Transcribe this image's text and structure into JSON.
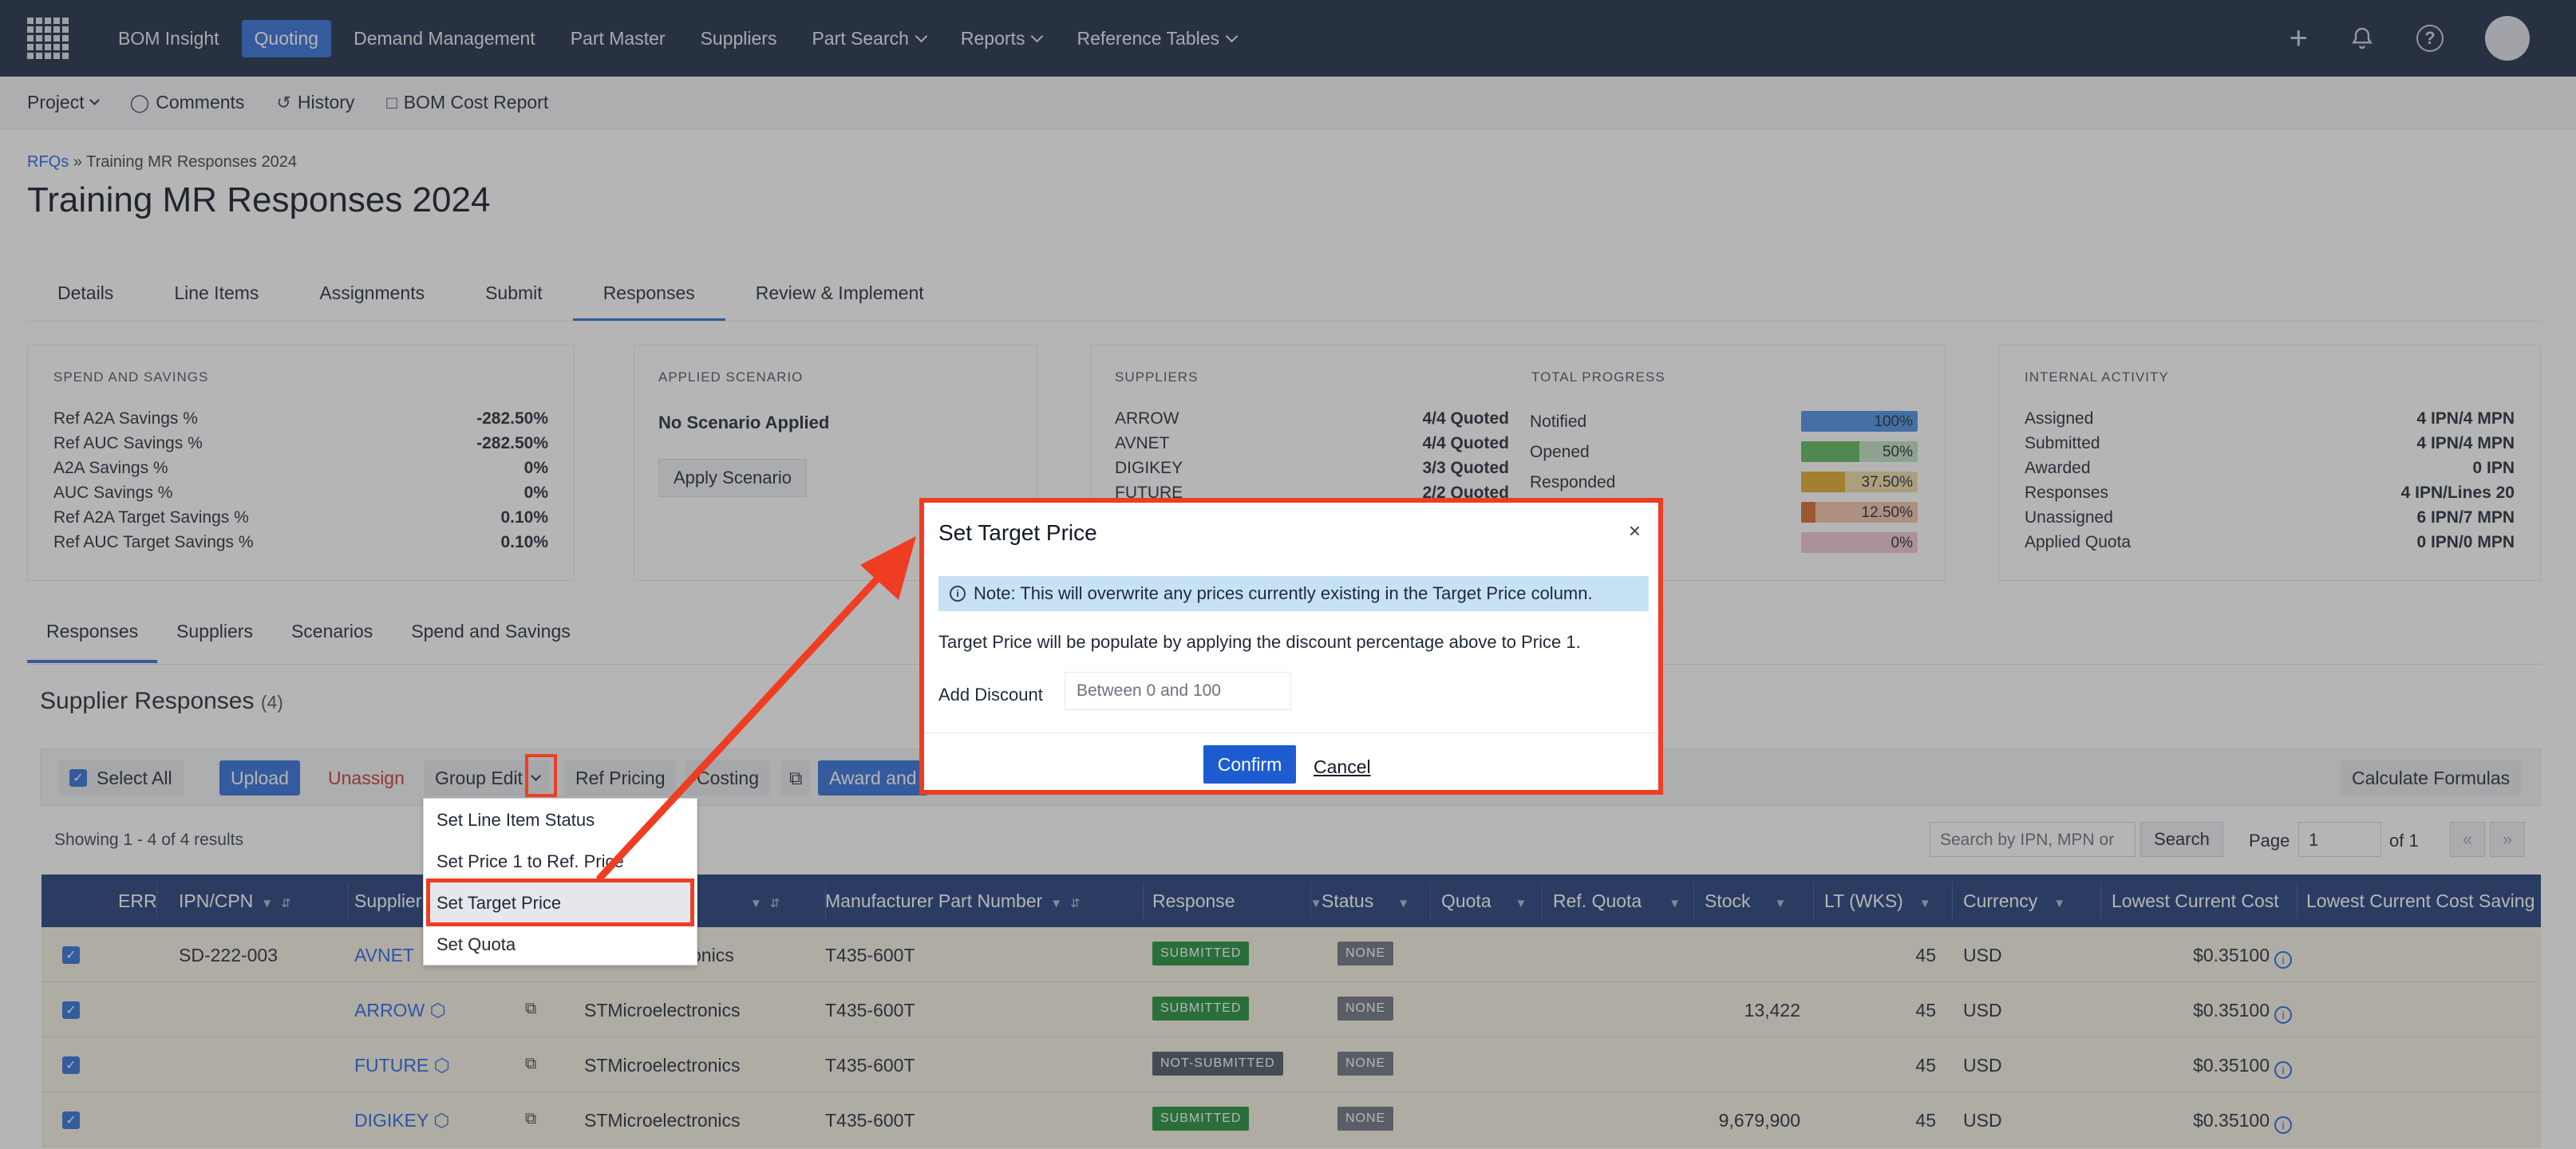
{
  "nav": {
    "items": [
      {
        "label": "BOM Insight"
      },
      {
        "label": "Quoting"
      },
      {
        "label": "Demand Management"
      },
      {
        "label": "Part Master"
      },
      {
        "label": "Suppliers"
      },
      {
        "label": "Part Search"
      },
      {
        "label": "Reports"
      },
      {
        "label": "Reference Tables"
      }
    ],
    "plus": "+",
    "help": "?"
  },
  "subbar": {
    "project": "Project",
    "comments": "Comments",
    "history": "History",
    "bom_cost_report": "BOM Cost Report"
  },
  "breadcrumb": {
    "root": "RFQs",
    "sep": "»",
    "current": "Training MR Responses 2024"
  },
  "page_title": "Training MR Responses 2024",
  "tabs": [
    "Details",
    "Line Items",
    "Assignments",
    "Submit",
    "Responses",
    "Review & Implement"
  ],
  "cards": {
    "spend": {
      "title": "SPEND AND SAVINGS",
      "rows": [
        {
          "k": "Ref A2A Savings %",
          "v": "-282.50%"
        },
        {
          "k": "Ref AUC Savings %",
          "v": "-282.50%"
        },
        {
          "k": "A2A Savings %",
          "v": "0%"
        },
        {
          "k": "AUC Savings %",
          "v": "0%"
        },
        {
          "k": "Ref A2A Target Savings %",
          "v": "0.10%"
        },
        {
          "k": "Ref AUC Target Savings %",
          "v": "0.10%"
        }
      ]
    },
    "scenario": {
      "title": "APPLIED SCENARIO",
      "status": "No Scenario Applied",
      "button": "Apply Scenario"
    },
    "suppliers": {
      "title": "SUPPLIERS",
      "rows": [
        {
          "k": "ARROW",
          "v": "4/4 Quoted"
        },
        {
          "k": "AVNET",
          "v": "4/4 Quoted"
        },
        {
          "k": "DIGIKEY",
          "v": "3/3 Quoted"
        },
        {
          "k": "FUTURE",
          "v": "2/2 Quoted"
        }
      ]
    },
    "progress": {
      "title": "TOTAL PROGRESS",
      "rows": [
        {
          "k": "Notified",
          "v": "100%",
          "frac": 1.0,
          "color": "#4a90e2",
          "bg": "#b9d3f1"
        },
        {
          "k": "Opened",
          "v": "50%",
          "frac": 0.5,
          "color": "#5cb85c",
          "bg": "#bfe2bf"
        },
        {
          "k": "Responded",
          "v": "37.50%",
          "frac": 0.375,
          "color": "#e0a92b",
          "bg": "#f1dba5"
        },
        {
          "k": "",
          "v": "12.50%",
          "frac": 0.125,
          "color": "#d9682b",
          "bg": "#f2c4a8"
        },
        {
          "k": "",
          "v": "0%",
          "frac": 0.0,
          "color": "#d77a9b",
          "bg": "#f1c4d3"
        }
      ]
    },
    "internal": {
      "title": "INTERNAL ACTIVITY",
      "rows": [
        {
          "k": "Assigned",
          "v": "4 IPN/4 MPN"
        },
        {
          "k": "Submitted",
          "v": "4 IPN/4 MPN"
        },
        {
          "k": "Awarded",
          "v": "0 IPN"
        },
        {
          "k": "Responses",
          "v": "4 IPN/Lines 20"
        },
        {
          "k": "Unassigned",
          "v": "6 IPN/7 MPN"
        },
        {
          "k": "Applied Quota",
          "v": "0 IPN/0 MPN"
        }
      ]
    }
  },
  "tabs2": [
    "Responses",
    "Suppliers",
    "Scenarios",
    "Spend and Savings"
  ],
  "section": {
    "title": "Supplier Responses",
    "count": "(4)"
  },
  "toolbar": {
    "select_all": "Select All",
    "upload": "Upload",
    "unassign": "Unassign",
    "group_edit": "Group Edit",
    "ref_pricing": "Ref Pricing",
    "costing": "Costing",
    "award": "Award and",
    "calc": "Calculate Formulas"
  },
  "showing": "Showing 1 - 4 of 4 results",
  "search": {
    "placeholder": "Search by IPN, MPN or",
    "button": "Search"
  },
  "pager": {
    "label": "Page",
    "value": "1",
    "of": "of 1",
    "prev": "«",
    "next": "»"
  },
  "table": {
    "headers": [
      "ERR",
      "IPN/CPN",
      "Supplier",
      "",
      "Manufacturer Part Number",
      "Response",
      "Status",
      "Quota",
      "Ref. Quota",
      "Stock",
      "LT (WKS)",
      "Currency",
      "Lowest Current Cost",
      "Lowest Current Cost Saving"
    ],
    "rows": [
      {
        "ipn": "SD-222-003",
        "supplier": "AVNET",
        "mfr": "onics",
        "mpn": "T435-600T",
        "response": "SUBMITTED",
        "status": "NONE",
        "stock": "",
        "lt": "45",
        "currency": "USD",
        "cost": "$0.35100"
      },
      {
        "ipn": "",
        "supplier": "ARROW",
        "mfr": "STMicroelectronics",
        "mpn": "T435-600T",
        "response": "SUBMITTED",
        "status": "NONE",
        "stock": "13,422",
        "lt": "45",
        "currency": "USD",
        "cost": "$0.35100"
      },
      {
        "ipn": "",
        "supplier": "FUTURE",
        "mfr": "STMicroelectronics",
        "mpn": "T435-600T",
        "response": "NOT-SUBMITTED",
        "status": "NONE",
        "stock": "",
        "lt": "45",
        "currency": "USD",
        "cost": "$0.35100"
      },
      {
        "ipn": "",
        "supplier": "DIGIKEY",
        "mfr": "STMicroelectronics",
        "mpn": "T435-600T",
        "response": "SUBMITTED",
        "status": "NONE",
        "stock": "9,679,900",
        "lt": "45",
        "currency": "USD",
        "cost": "$0.35100"
      }
    ]
  },
  "dropdown": {
    "items": [
      "Set Line Item Status",
      "Set Price 1 to Ref. Price",
      "Set Target Price",
      "Set Quota"
    ]
  },
  "modal": {
    "title": "Set Target Price",
    "close": "×",
    "note": "Note: This will overwrite any prices currently existing in the Target Price column.",
    "description": "Target Price will be populate by applying the discount percentage above to Price 1.",
    "discount_label": "Add Discount",
    "discount_placeholder": "Between 0 and 100",
    "confirm": "Confirm",
    "cancel": "Cancel"
  },
  "colors": {
    "nav_bg": "#1c2a44",
    "accent": "#2f6ed8",
    "highlight": "#ef3d23",
    "table_header": "#1f3c7a"
  }
}
